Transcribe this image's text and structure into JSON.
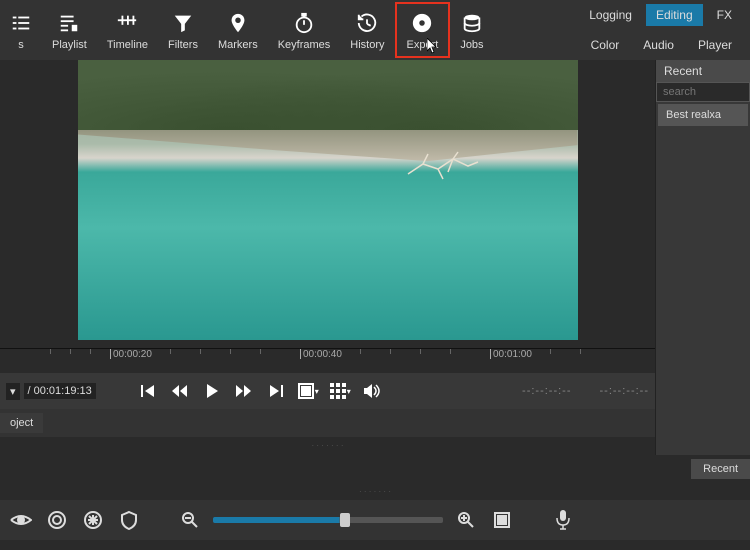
{
  "toolbar": {
    "items": [
      {
        "label": "s",
        "icon": "list"
      },
      {
        "label": "Playlist",
        "icon": "playlist"
      },
      {
        "label": "Timeline",
        "icon": "timeline"
      },
      {
        "label": "Filters",
        "icon": "funnel"
      },
      {
        "label": "Markers",
        "icon": "marker"
      },
      {
        "label": "Keyframes",
        "icon": "stopwatch"
      },
      {
        "label": "History",
        "icon": "history"
      },
      {
        "label": "Export",
        "icon": "disc"
      },
      {
        "label": "Jobs",
        "icon": "stack"
      }
    ]
  },
  "mode_tabs": {
    "row1": [
      "Logging",
      "Editing",
      "FX"
    ],
    "row2": [
      "Color",
      "Audio",
      "Player"
    ],
    "active": "Editing"
  },
  "right_panel": {
    "title": "Recent",
    "search_placeholder": "search",
    "items": [
      "Best realxa"
    ]
  },
  "ruler": {
    "marks": [
      "00:00:20",
      "00:00:40",
      "00:01:00"
    ]
  },
  "transport": {
    "timecode": "/ 00:01:19:13",
    "empty_tc": "--:--:--:--"
  },
  "project_tab": "oject",
  "recent_button": "Recent"
}
